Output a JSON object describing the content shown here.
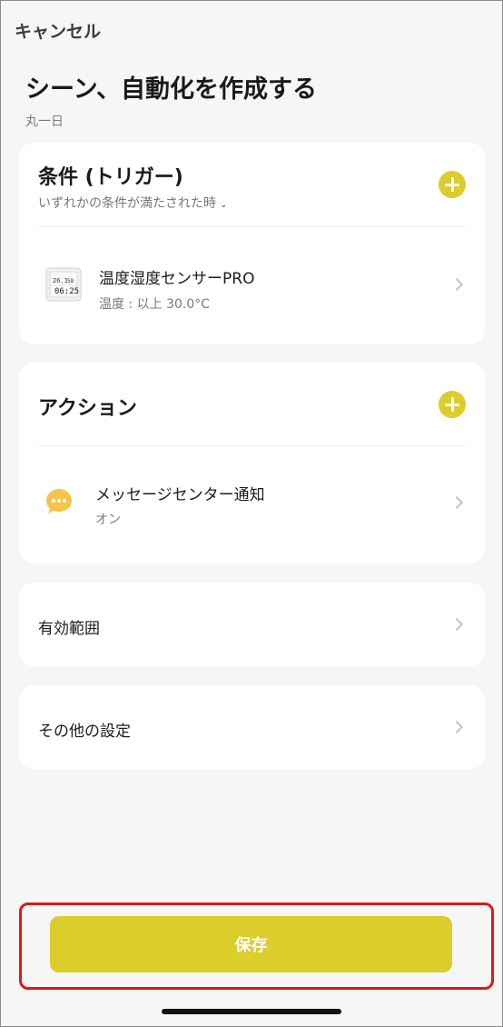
{
  "header": {
    "cancel_label": "キャンセル",
    "title": "シーン、自動化を作成する",
    "subtitle": "丸一日"
  },
  "conditions": {
    "title": "条件 (トリガー)",
    "mode_label": "いずれかの条件が満たされた時",
    "items": [
      {
        "title": "温度湿度センサーPRO",
        "detail": "温度 : 以上 30.0°C",
        "device_display": {
          "temp": "26.1",
          "humidity": "58",
          "time": "06:25"
        }
      }
    ]
  },
  "actions": {
    "title": "アクション",
    "items": [
      {
        "title": "メッセージセンター通知",
        "detail": "オン"
      }
    ]
  },
  "effective_scope": {
    "label": "有効範囲"
  },
  "other_settings": {
    "label": "その他の設定"
  },
  "footer": {
    "save_label": "保存"
  },
  "colors": {
    "accent": "#dccc2c",
    "highlight_border": "#e01818",
    "background": "#f6f6f6"
  }
}
